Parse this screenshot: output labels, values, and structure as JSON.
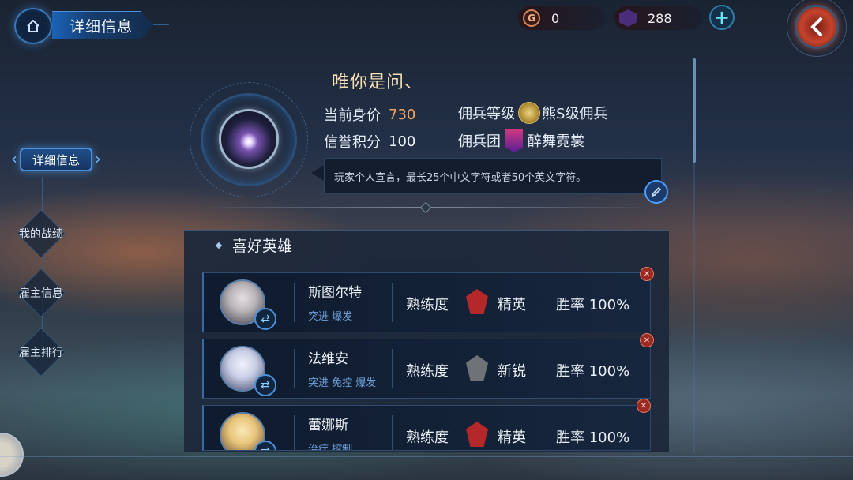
{
  "header": {
    "breadcrumb_title": "详细信息",
    "gold_label": "G",
    "gold_value": "0",
    "gem_value": "288",
    "plus_label": "+"
  },
  "icons": {
    "home": "home-icon",
    "back": "chevron-left-icon",
    "gem": "gem-icon",
    "coin": "coin-icon",
    "edit": "pencil-icon",
    "swap": "swap-icon",
    "trash": "trash-icon"
  },
  "nav": {
    "active": "详细信息",
    "items": [
      "我的战绩",
      "雇主信息",
      "雇主排行"
    ]
  },
  "profile": {
    "name": "唯你是问、",
    "value_label": "当前身价",
    "value": "730",
    "credit_label": "信誉积分",
    "credit": "100",
    "merc_level_label": "佣兵等级",
    "merc_level": "熊S级佣兵",
    "merc_group_label": "佣兵团",
    "merc_group": "醉舞霓裳",
    "declaration": "玩家个人宣言，最长25个中文字符或者50个英文字符。"
  },
  "favorites": {
    "title": "喜好英雄",
    "heroes": [
      {
        "name": "斯图尔特",
        "tags": "突进 爆发",
        "proficiency_label": "熟练度",
        "rank": "精英",
        "rank_color": "#b5282a",
        "winrate": "胜率 100%",
        "portrait_color": "#b8b4b8"
      },
      {
        "name": "法维安",
        "tags": "突进 免控 爆发",
        "proficiency_label": "熟练度",
        "rank": "新锐",
        "rank_color": "#6e7378",
        "winrate": "胜率 100%",
        "portrait_color": "#c9cfe6"
      },
      {
        "name": "蕾娜斯",
        "tags": "治疗 控制",
        "proficiency_label": "熟练度",
        "rank": "精英",
        "rank_color": "#b5282a",
        "winrate": "胜率 100%",
        "portrait_color": "#e8c57a"
      }
    ]
  },
  "colors": {
    "accent_blue": "#4a8fdc",
    "value_orange": "#f3a45e",
    "name_gold": "#f6deb2",
    "tag_blue": "#6ea0d8"
  }
}
